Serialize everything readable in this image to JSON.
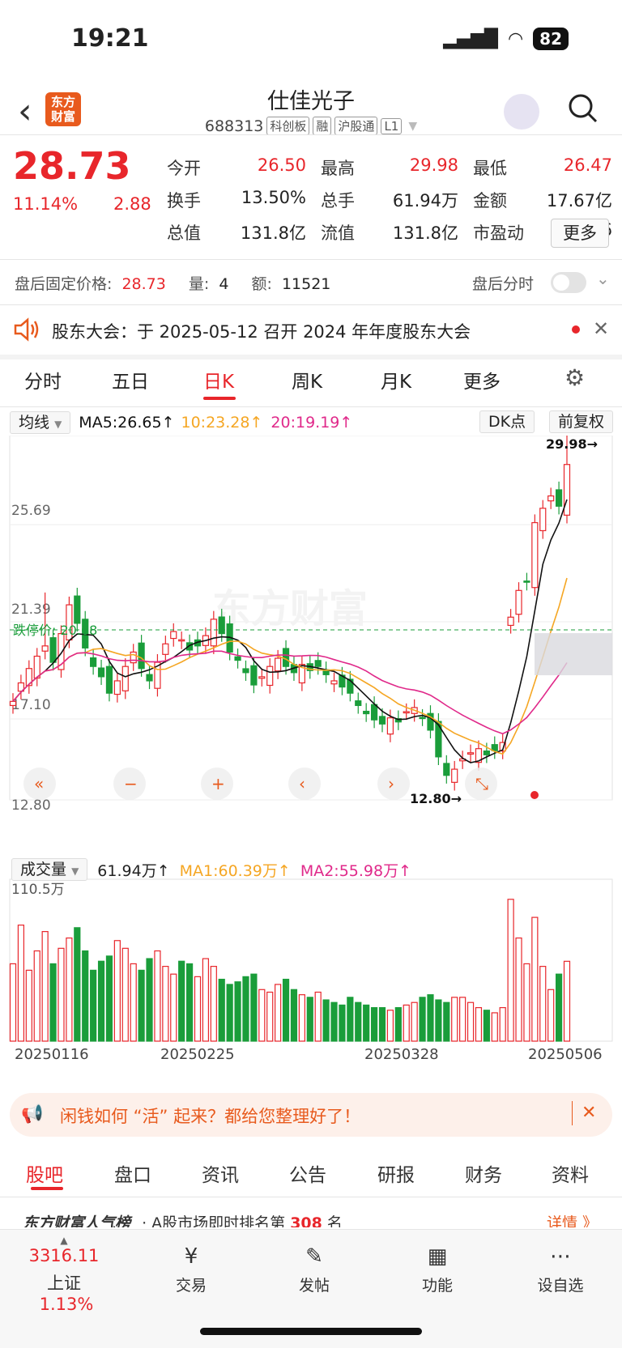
{
  "status_bar": {
    "time": "19:21",
    "battery": "82"
  },
  "header": {
    "logo": "东方财富",
    "name": "仕佳光子",
    "code": "688313",
    "tags": [
      "科创板",
      "融",
      "沪股通",
      "L1"
    ]
  },
  "quote": {
    "price": "28.73",
    "change_pct": "11.14%",
    "change": "2.88",
    "fields": [
      {
        "label": "今开",
        "value": "26.50",
        "color": "red"
      },
      {
        "label": "最高",
        "value": "29.98",
        "color": "red"
      },
      {
        "label": "最低",
        "value": "26.47",
        "color": "red"
      },
      {
        "label": "换手",
        "value": "13.50%",
        "color": "plain"
      },
      {
        "label": "总手",
        "value": "61.94万",
        "color": "plain"
      },
      {
        "label": "金额",
        "value": "17.67亿",
        "color": "plain"
      },
      {
        "label": "总值",
        "value": "131.8亿",
        "color": "plain"
      },
      {
        "label": "流值",
        "value": "131.8亿",
        "color": "plain"
      },
      {
        "label": "市盈动",
        "value": "35.36",
        "color": "plain"
      }
    ],
    "more": "更多"
  },
  "after_hours": {
    "label": "盘后固定价格:",
    "price": "28.73",
    "vol_label": "量:",
    "vol": "4",
    "amt_label": "额:",
    "amt": "11521",
    "switch_label": "盘后分时"
  },
  "notice": "股东大会：于 2025-05-12 召开 2024 年年度股东大会",
  "chart_tabs": [
    "分时",
    "五日",
    "日K",
    "周K",
    "月K",
    "更多"
  ],
  "active_tab": "日K",
  "kline_legend": {
    "selector": "均线",
    "ma5": "MA5:26.65↑",
    "ma10": "10:23.28↑",
    "ma20": "20:19.19↑",
    "dk": "DK点",
    "adjust": "前复权"
  },
  "kline_labels": {
    "y_ticks": [
      "29.98",
      "25.69",
      "21.39",
      "17.10",
      "12.80"
    ],
    "limit_down": "跌停价: 20.68",
    "high_marker": "29.98→",
    "low_marker": "12.80→",
    "watermark": "东方财富"
  },
  "volume_legend": {
    "selector": "成交量",
    "vol": "61.94万↑",
    "ma1": "MA1:60.39万↑",
    "ma2": "MA2:55.98万↑",
    "max": "110.5万"
  },
  "x_labels": [
    "20250116",
    "20250225",
    "20250328",
    "20250506"
  ],
  "promo": "闲钱如何 “活” 起来？都给您整理好了！",
  "bottom_tabs": [
    "股吧",
    "盘口",
    "资讯",
    "公告",
    "研报",
    "财务",
    "资料"
  ],
  "active_bottom_tab": "股吧",
  "rank_row": {
    "title": "东方财富人气榜",
    "text": "· A股市场即时排名第",
    "rank": "308",
    "unit": "名",
    "link": "详情 》"
  },
  "footer": {
    "index_value": "3316.11",
    "index_name": "上证",
    "index_pct": "1.13%",
    "items": [
      "交易",
      "发帖",
      "功能",
      "设自选"
    ]
  },
  "colors": {
    "up": "#e8262b",
    "down": "#1a9d3a",
    "ma5": "#111111",
    "ma10": "#f5a623",
    "ma20": "#e0298a",
    "brand": "#e85a1d"
  }
}
